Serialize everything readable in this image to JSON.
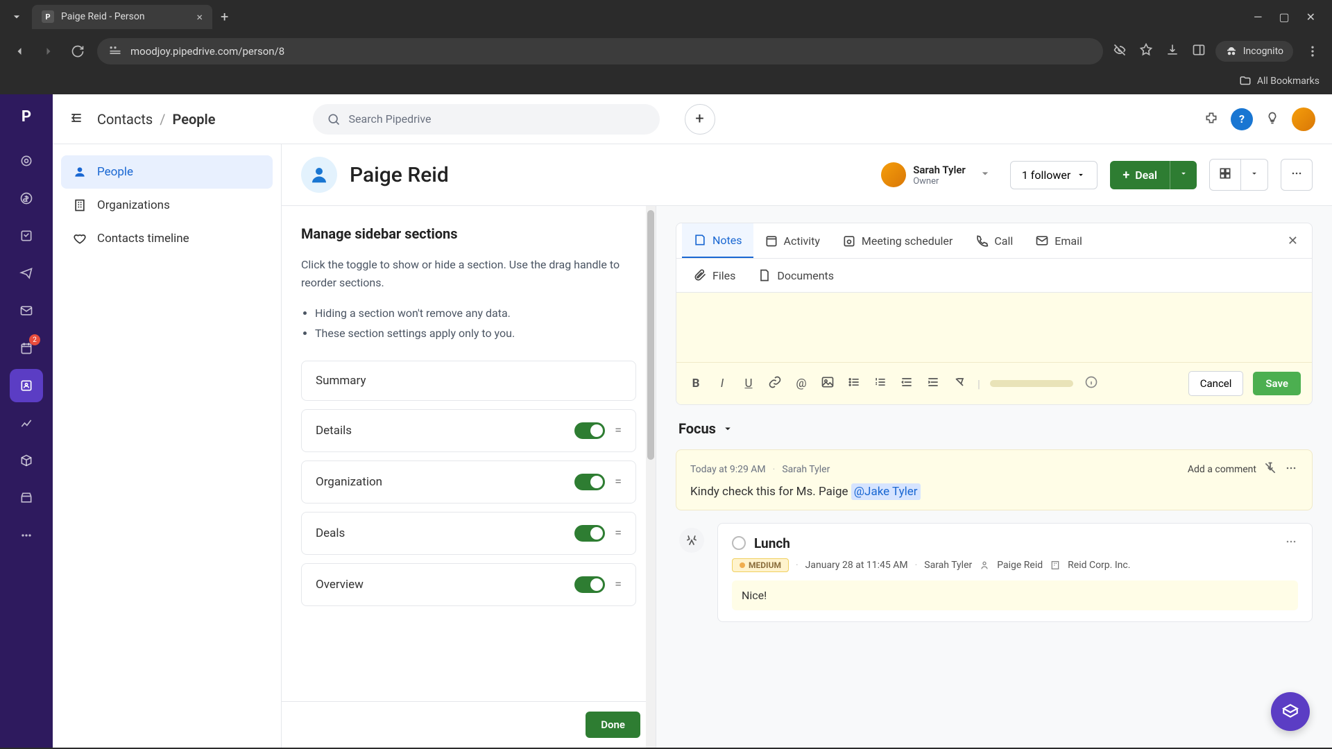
{
  "browser": {
    "tab_title": "Paige Reid - Person",
    "url": "moodjoy.pipedrive.com/person/8",
    "incognito_label": "Incognito",
    "all_bookmarks": "All Bookmarks",
    "favicon_letter": "P"
  },
  "topbar": {
    "breadcrumb_root": "Contacts",
    "breadcrumb_current": "People",
    "search_placeholder": "Search Pipedrive"
  },
  "rail": {
    "badge_count": "2"
  },
  "sidenav": {
    "items": [
      {
        "label": "People",
        "active": true
      },
      {
        "label": "Organizations",
        "active": false
      },
      {
        "label": "Contacts timeline",
        "active": false
      }
    ]
  },
  "person": {
    "name": "Paige Reid",
    "owner_name": "Sarah Tyler",
    "owner_role": "Owner",
    "followers_label": "1 follower",
    "deal_label": "Deal"
  },
  "manage": {
    "title": "Manage sidebar sections",
    "description": "Click the toggle to show or hide a section. Use the drag handle to reorder sections.",
    "bullets": [
      "Hiding a section won't remove any data.",
      "These section settings apply only to you."
    ],
    "sections": [
      {
        "label": "Summary",
        "toggle": false,
        "drag": false
      },
      {
        "label": "Details",
        "toggle": true,
        "drag": true
      },
      {
        "label": "Organization",
        "toggle": true,
        "drag": true
      },
      {
        "label": "Deals",
        "toggle": true,
        "drag": true
      },
      {
        "label": "Overview",
        "toggle": true,
        "drag": true
      }
    ],
    "done_label": "Done"
  },
  "composer": {
    "tabs": [
      "Notes",
      "Activity",
      "Meeting scheduler",
      "Call",
      "Email"
    ],
    "tabs_row2": [
      "Files",
      "Documents"
    ],
    "cancel_label": "Cancel",
    "save_label": "Save"
  },
  "focus_label": "Focus",
  "note": {
    "timestamp": "Today at 9:29 AM",
    "author": "Sarah Tyler",
    "add_comment": "Add a comment",
    "body_text": "Kindy check this for Ms. Paige ",
    "mention": "@Jake Tyler"
  },
  "activity": {
    "title": "Lunch",
    "priority": "MEDIUM",
    "datetime": "January 28 at 11:45 AM",
    "owner": "Sarah Tyler",
    "person": "Paige Reid",
    "org": "Reid Corp. Inc.",
    "note": "Nice!"
  }
}
